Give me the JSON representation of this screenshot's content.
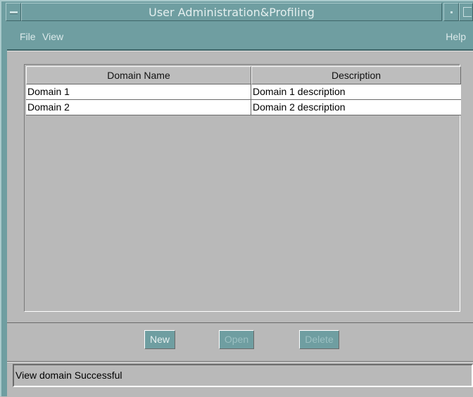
{
  "window": {
    "title": "User Administration&Profiling"
  },
  "menubar": {
    "file": "File",
    "view": "View",
    "help": "Help"
  },
  "table": {
    "columns": [
      "Domain Name",
      "Description"
    ],
    "rows": [
      [
        "Domain 1",
        "Domain 1 description"
      ],
      [
        "Domain 2",
        "Domain 2 description"
      ]
    ]
  },
  "buttons": {
    "new": "New",
    "open": "Open",
    "delete": "Delete"
  },
  "status": {
    "text": "View domain Successful"
  },
  "colors": {
    "frame": "#6f9ea1",
    "background": "#b9b9b9"
  },
  "icons": {
    "window_menu": "window-menu-icon",
    "minimize": "minimize-icon",
    "maximize": "maximize-icon"
  }
}
